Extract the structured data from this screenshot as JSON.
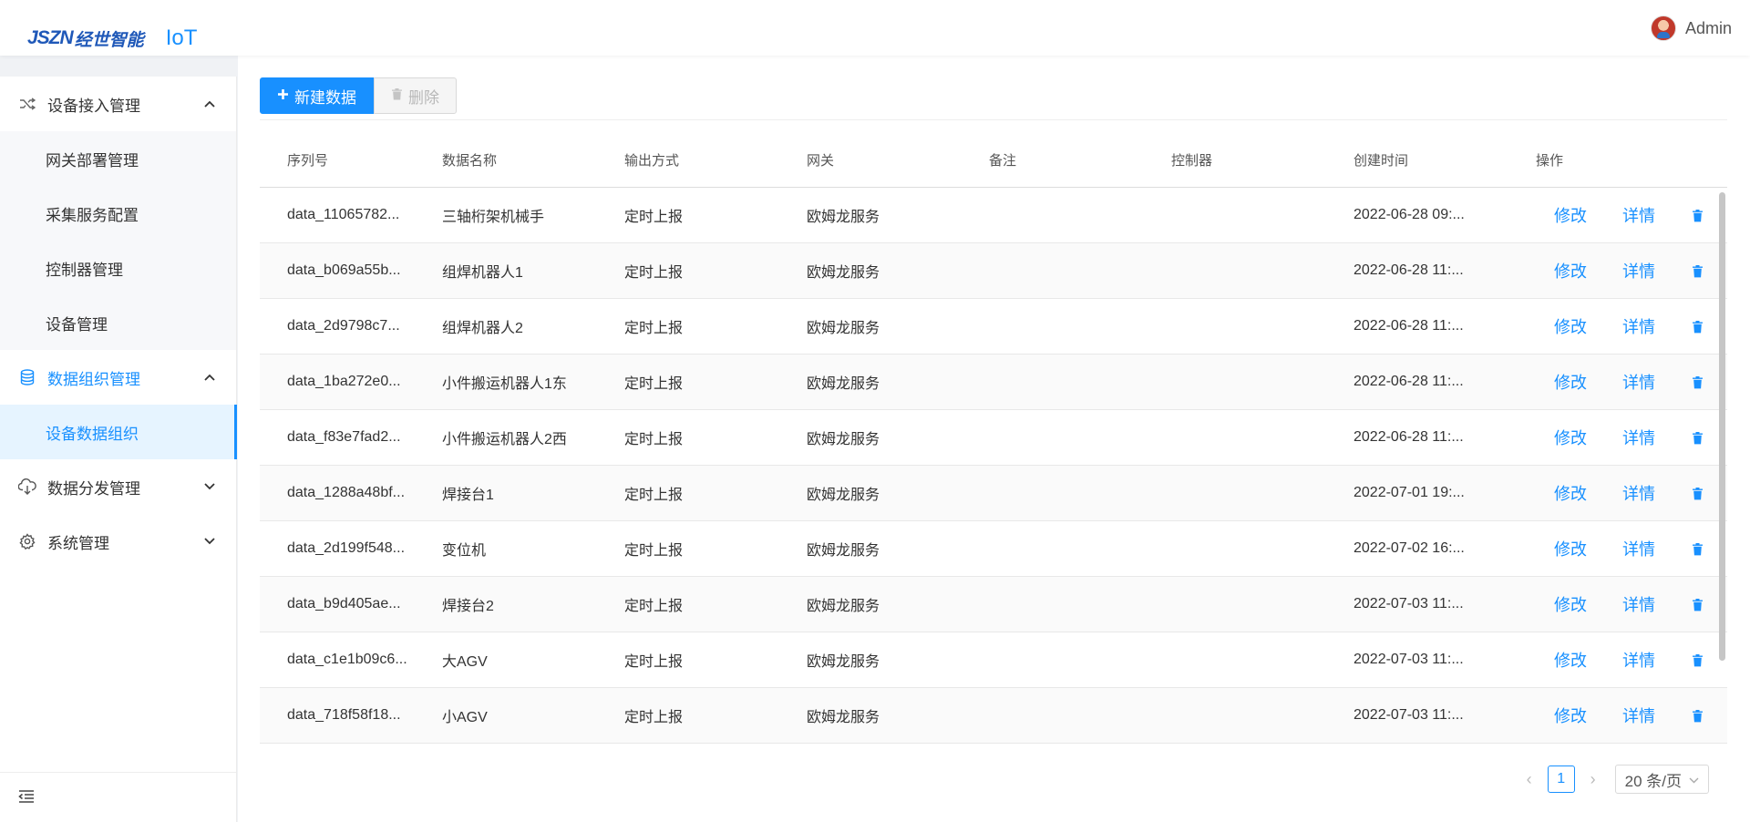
{
  "brand": {
    "logo": "JSZN",
    "logo_cn": "经世智能",
    "product": "IoT"
  },
  "user": {
    "name": "Admin"
  },
  "sidebar": {
    "groups": [
      {
        "label": "设备接入管理",
        "icon": "shuffle-icon",
        "expanded": true,
        "items": [
          {
            "label": "网关部署管理"
          },
          {
            "label": "采集服务配置"
          },
          {
            "label": "控制器管理"
          },
          {
            "label": "设备管理"
          }
        ]
      },
      {
        "label": "数据组织管理",
        "icon": "database-icon",
        "expanded": true,
        "active": true,
        "items": [
          {
            "label": "设备数据组织",
            "active": true
          }
        ]
      },
      {
        "label": "数据分发管理",
        "icon": "cloud-download-icon",
        "expanded": false
      },
      {
        "label": "系统管理",
        "icon": "gear-icon",
        "expanded": false
      }
    ]
  },
  "toolbar": {
    "new_label": "新建数据",
    "delete_label": "删除"
  },
  "table": {
    "columns": [
      "序列号",
      "数据名称",
      "输出方式",
      "网关",
      "备注",
      "控制器",
      "创建时间",
      "操作"
    ],
    "rows": [
      {
        "id": "data_11065782...",
        "name": "三轴桁架机械手",
        "output": "定时上报",
        "gateway": "欧姆龙服务",
        "note": "",
        "controller": "",
        "created": "2022-06-28 09:..."
      },
      {
        "id": "data_b069a55b...",
        "name": "组焊机器人1",
        "output": "定时上报",
        "gateway": "欧姆龙服务",
        "note": "",
        "controller": "",
        "created": "2022-06-28 11:..."
      },
      {
        "id": "data_2d9798c7...",
        "name": "组焊机器人2",
        "output": "定时上报",
        "gateway": "欧姆龙服务",
        "note": "",
        "controller": "",
        "created": "2022-06-28 11:..."
      },
      {
        "id": "data_1ba272e0...",
        "name": "小件搬运机器人1东",
        "output": "定时上报",
        "gateway": "欧姆龙服务",
        "note": "",
        "controller": "",
        "created": "2022-06-28 11:..."
      },
      {
        "id": "data_f83e7fad2...",
        "name": "小件搬运机器人2西",
        "output": "定时上报",
        "gateway": "欧姆龙服务",
        "note": "",
        "controller": "",
        "created": "2022-06-28 11:..."
      },
      {
        "id": "data_1288a48bf...",
        "name": "焊接台1",
        "output": "定时上报",
        "gateway": "欧姆龙服务",
        "note": "",
        "controller": "",
        "created": "2022-07-01 19:..."
      },
      {
        "id": "data_2d199f548...",
        "name": "变位机",
        "output": "定时上报",
        "gateway": "欧姆龙服务",
        "note": "",
        "controller": "",
        "created": "2022-07-02 16:..."
      },
      {
        "id": "data_b9d405ae...",
        "name": "焊接台2",
        "output": "定时上报",
        "gateway": "欧姆龙服务",
        "note": "",
        "controller": "",
        "created": "2022-07-03 11:..."
      },
      {
        "id": "data_c1e1b09c6...",
        "name": "大AGV",
        "output": "定时上报",
        "gateway": "欧姆龙服务",
        "note": "",
        "controller": "",
        "created": "2022-07-03 11:..."
      },
      {
        "id": "data_718f58f18...",
        "name": "小AGV",
        "output": "定时上报",
        "gateway": "欧姆龙服务",
        "note": "",
        "controller": "",
        "created": "2022-07-03 11:..."
      }
    ],
    "actions": {
      "edit": "修改",
      "detail": "详情"
    }
  },
  "pagination": {
    "current_page": "1",
    "page_size": "20 条/页",
    "prev": "‹",
    "next": "›"
  },
  "colors": {
    "primary": "#1890ff",
    "brand": "#1f58b8"
  }
}
